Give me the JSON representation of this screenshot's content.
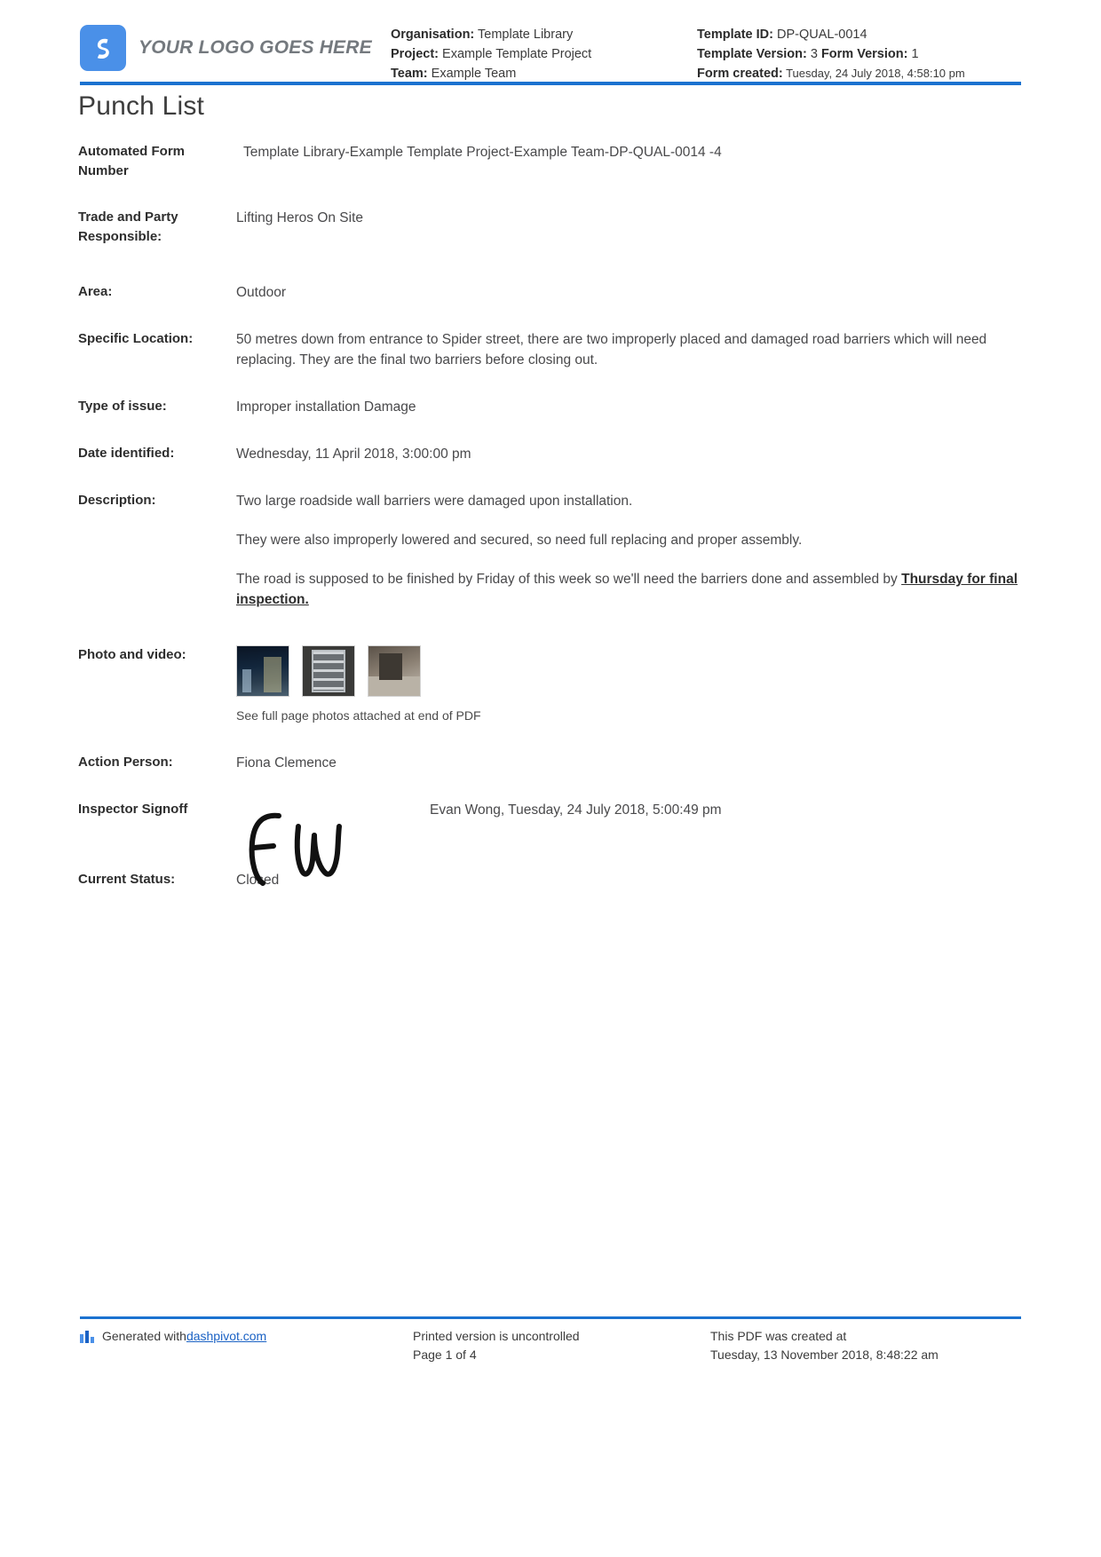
{
  "header": {
    "logo": {
      "icon": "dashpivot-logo-icon",
      "text": "YOUR LOGO GOES HERE",
      "brand_color": "#4a90e8"
    },
    "left_meta": [
      {
        "label": "Organisation:",
        "value": " Template Library"
      },
      {
        "label": "Project:",
        "value": " Example Template Project"
      },
      {
        "label": "Team:",
        "value": " Example Team"
      }
    ],
    "right_meta": {
      "template_id_label": "Template ID:",
      "template_id_value": " DP-QUAL-0014",
      "template_version_label": "Template Version:",
      "template_version_value": " 3 ",
      "form_version_label": "Form Version:",
      "form_version_value": " 1",
      "form_created_label": "Form created:",
      "form_created_value": " Tuesday, 24 July 2018, 4:58:10 pm"
    },
    "rule_color": "#1b72d0"
  },
  "title": "Punch List",
  "fields": {
    "automated_form_number": {
      "label": "Automated Form Number",
      "value": "Template Library-Example Template Project-Example Team-DP-QUAL-0014   -4"
    },
    "trade_and_party": {
      "label": "Trade and Party Responsible:",
      "value": "Lifting Heros On Site"
    },
    "area": {
      "label": "Area:",
      "value": "Outdoor"
    },
    "specific_location": {
      "label": "Specific Location:",
      "value": "50 metres down from entrance to Spider street, there are two improperly placed and damaged road barriers which will need replacing. They are the final two barriers before closing out."
    },
    "type_of_issue": {
      "label": "Type of issue:",
      "value": "Improper installation   Damage"
    },
    "date_identified": {
      "label": "Date identified:",
      "value": "Wednesday, 11 April 2018, 3:00:00 pm"
    },
    "description": {
      "label": "Description:",
      "para1": "Two large roadside wall barriers were damaged upon installation.",
      "para2": "They were also improperly lowered and secured, so need full replacing and proper assembly.",
      "para3_prefix": "The road is supposed to be finished by Friday of this week so we'll need the barriers done and assembled by ",
      "para3_emphasis": "Thursday for final inspection."
    },
    "photo_and_video": {
      "label": "Photo and video:",
      "caption": "See full page photos attached at end of PDF",
      "thumbnails": [
        "photo-thumbnail-night-site",
        "photo-thumbnail-scaffold-panel",
        "photo-thumbnail-barrier-ground"
      ]
    },
    "action_person": {
      "label": "Action Person:",
      "value": "Fiona Clemence"
    },
    "inspector_signoff": {
      "label": "Inspector Signoff",
      "signature_initials": "E W",
      "value": "Evan Wong, Tuesday, 24 July 2018, 5:00:49 pm"
    },
    "current_status": {
      "label": "Current Status:",
      "value": "Closed"
    }
  },
  "footer": {
    "generated_prefix": "Generated with ",
    "generated_link": "dashpivot.com",
    "printed_note": "Printed version is uncontrolled",
    "page_number": "Page 1 of 4",
    "created_note": "This PDF was created at",
    "created_timestamp": "Tuesday, 13 November 2018, 8:48:22 am",
    "link_color": "#1b62c4"
  }
}
